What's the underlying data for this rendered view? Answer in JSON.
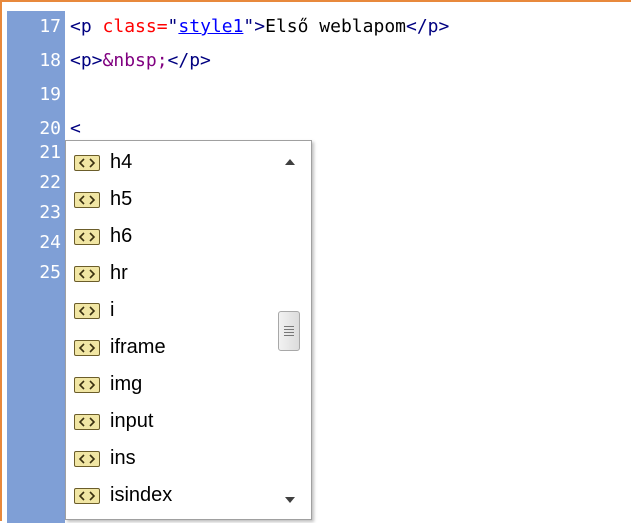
{
  "editor": {
    "line_numbers": [
      "17",
      "18",
      "19",
      "20",
      "21",
      "22",
      "23",
      "24",
      "25"
    ],
    "lines": {
      "line17": {
        "open_tag": "<p ",
        "attr": "class=",
        "quote_open": "\"",
        "value": "style1",
        "quote_close": "\"",
        "after_attr": ">",
        "text": "Első weblapom",
        "close_tag": "</p>"
      },
      "line18": {
        "open_tag": "<p>",
        "entity": "&nbsp;",
        "close_tag": "</p>"
      },
      "line20": {
        "typed": "<"
      }
    }
  },
  "autocomplete": {
    "items": [
      {
        "label": "h4",
        "icon": "html-tag-icon"
      },
      {
        "label": "h5",
        "icon": "html-tag-icon"
      },
      {
        "label": "h6",
        "icon": "html-tag-icon"
      },
      {
        "label": "hr",
        "icon": "html-tag-icon"
      },
      {
        "label": "i",
        "icon": "html-tag-icon"
      },
      {
        "label": "iframe",
        "icon": "html-tag-icon"
      },
      {
        "label": "img",
        "icon": "html-tag-icon"
      },
      {
        "label": "input",
        "icon": "html-tag-icon"
      },
      {
        "label": "ins",
        "icon": "html-tag-icon"
      },
      {
        "label": "isindex",
        "icon": "html-tag-icon"
      }
    ]
  },
  "colors": {
    "gutter": "#7f9fd6",
    "tag": "#000080",
    "attribute": "#ff0000",
    "value": "#0000ff",
    "entity": "#800080",
    "border_accent": "#e8893c"
  }
}
